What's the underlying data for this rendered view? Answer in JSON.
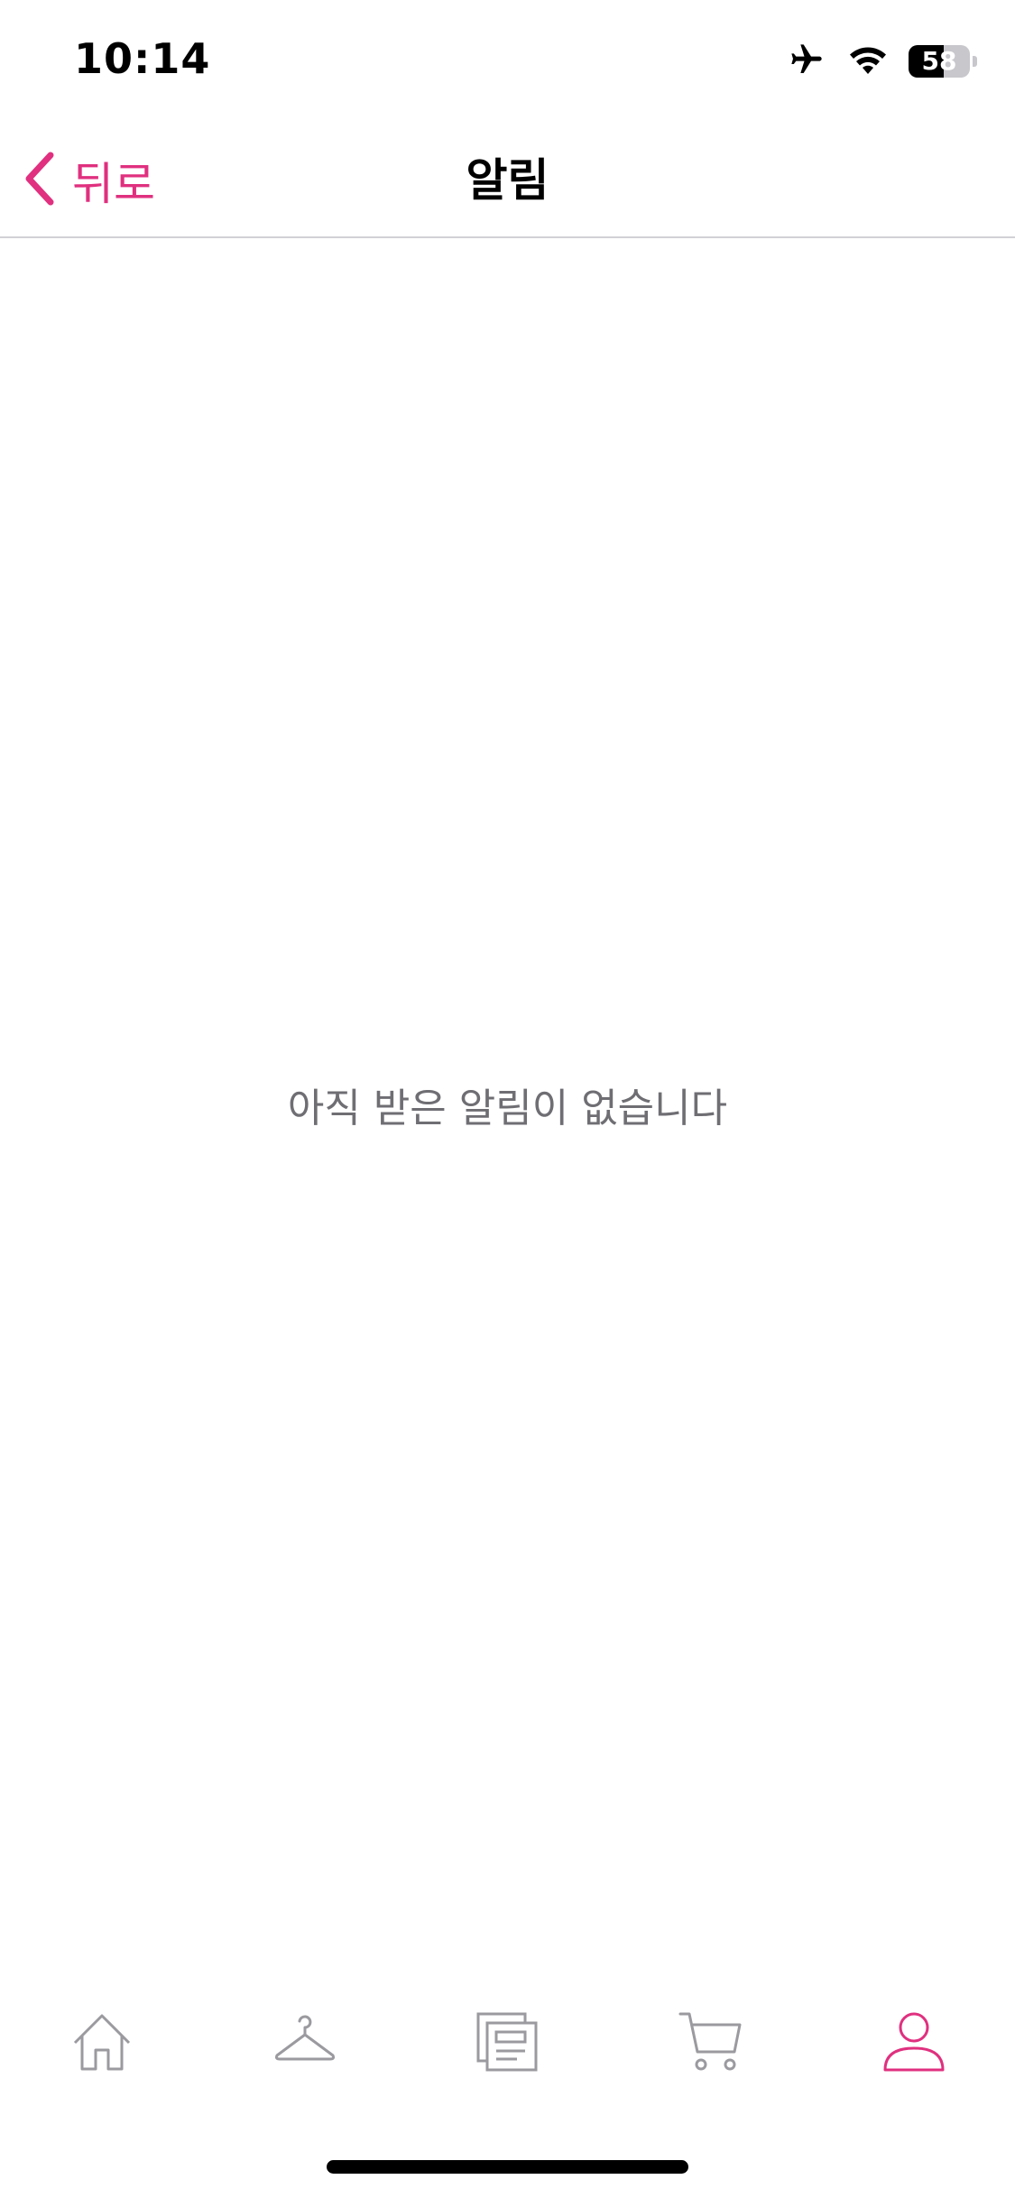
{
  "status_bar": {
    "time": "10:14",
    "battery_percent": 58,
    "battery_label": "58",
    "icons": [
      "airplane-icon",
      "wifi-icon",
      "battery-icon"
    ]
  },
  "nav": {
    "back_label": "뒤로",
    "title": "알림"
  },
  "content": {
    "empty_message": "아직 받은 알림이 없습니다"
  },
  "tab_bar": {
    "items": [
      {
        "icon": "home-icon",
        "active": false
      },
      {
        "icon": "hanger-icon",
        "active": false
      },
      {
        "icon": "catalog-icon",
        "active": false
      },
      {
        "icon": "cart-icon",
        "active": false
      },
      {
        "icon": "profile-icon",
        "active": true
      }
    ]
  },
  "colors": {
    "accent": "#e0307f",
    "inactive_icon": "#9a9a9f",
    "empty_text": "#6e6e73",
    "divider": "#d1d1d6"
  }
}
